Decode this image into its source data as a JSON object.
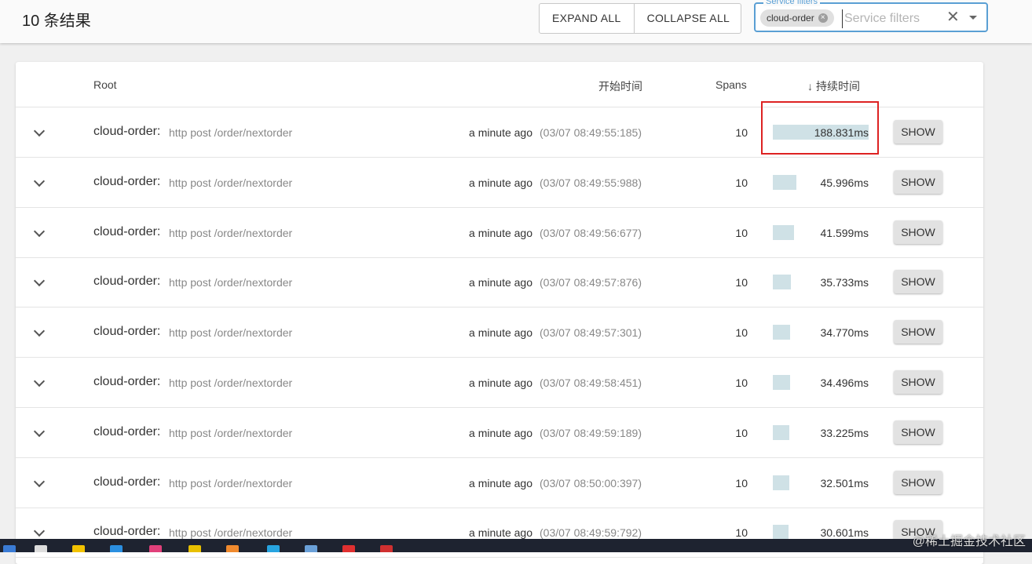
{
  "header": {
    "result_count": "10 条结果",
    "expand_all": "EXPAND ALL",
    "collapse_all": "COLLAPSE ALL",
    "filter": {
      "legend": "Service filters",
      "chip": "cloud-order",
      "placeholder": "Service filters"
    }
  },
  "table": {
    "columns": {
      "root": "Root",
      "start_time": "开始时间",
      "spans": "Spans",
      "duration": "持续时间"
    },
    "sort": {
      "column": "duration",
      "direction": "descending"
    },
    "rows": [
      {
        "service": "cloud-order:",
        "operation": "http post /order/nextorder",
        "relative": "a minute ago",
        "timestamp": "(03/07 08:49:55:185)",
        "spans": "10",
        "duration": "188.831ms",
        "duration_fraction": 1.0,
        "show": "SHOW"
      },
      {
        "service": "cloud-order:",
        "operation": "http post /order/nextorder",
        "relative": "a minute ago",
        "timestamp": "(03/07 08:49:55:988)",
        "spans": "10",
        "duration": "45.996ms",
        "duration_fraction": 0.244,
        "show": "SHOW"
      },
      {
        "service": "cloud-order:",
        "operation": "http post /order/nextorder",
        "relative": "a minute ago",
        "timestamp": "(03/07 08:49:56:677)",
        "spans": "10",
        "duration": "41.599ms",
        "duration_fraction": 0.22,
        "show": "SHOW"
      },
      {
        "service": "cloud-order:",
        "operation": "http post /order/nextorder",
        "relative": "a minute ago",
        "timestamp": "(03/07 08:49:57:876)",
        "spans": "10",
        "duration": "35.733ms",
        "duration_fraction": 0.189,
        "show": "SHOW"
      },
      {
        "service": "cloud-order:",
        "operation": "http post /order/nextorder",
        "relative": "a minute ago",
        "timestamp": "(03/07 08:49:57:301)",
        "spans": "10",
        "duration": "34.770ms",
        "duration_fraction": 0.184,
        "show": "SHOW"
      },
      {
        "service": "cloud-order:",
        "operation": "http post /order/nextorder",
        "relative": "a minute ago",
        "timestamp": "(03/07 08:49:58:451)",
        "spans": "10",
        "duration": "34.496ms",
        "duration_fraction": 0.183,
        "show": "SHOW"
      },
      {
        "service": "cloud-order:",
        "operation": "http post /order/nextorder",
        "relative": "a minute ago",
        "timestamp": "(03/07 08:49:59:189)",
        "spans": "10",
        "duration": "33.225ms",
        "duration_fraction": 0.176,
        "show": "SHOW"
      },
      {
        "service": "cloud-order:",
        "operation": "http post /order/nextorder",
        "relative": "a minute ago",
        "timestamp": "(03/07 08:50:00:397)",
        "spans": "10",
        "duration": "32.501ms",
        "duration_fraction": 0.172,
        "show": "SHOW"
      },
      {
        "service": "cloud-order:",
        "operation": "http post /order/nextorder",
        "relative": "a minute ago",
        "timestamp": "(03/07 08:49:59:792)",
        "spans": "10",
        "duration": "30.601ms",
        "duration_fraction": 0.162,
        "show": "SHOW"
      }
    ]
  },
  "watermark": "@稀土掘金技术社区",
  "colors": {
    "bar": "#cfe1e6",
    "highlight": "#dd2222",
    "filter_accent": "#5a9fd4"
  }
}
